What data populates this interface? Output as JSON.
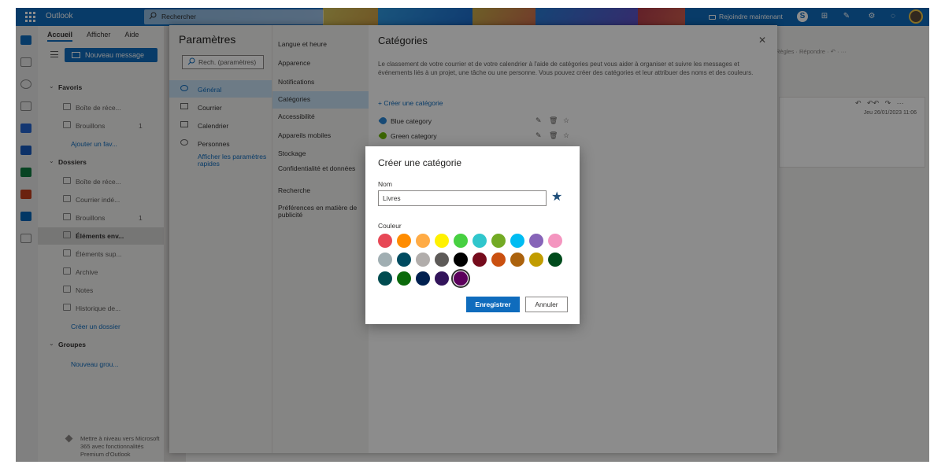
{
  "topbar": {
    "app_name": "Outlook",
    "search_placeholder": "Rechercher",
    "meet_now": "Rejoindre maintenant",
    "bg_color": "#0f6cbd"
  },
  "ribbon": {
    "tabs": [
      "Accueil",
      "Afficher",
      "Aide"
    ],
    "new_message": "Nouveau message"
  },
  "nav": {
    "favorites": "Favoris",
    "fav_inbox": "Boîte de réce...",
    "fav_drafts": "Brouillons",
    "fav_drafts_count": "1",
    "add_favorite": "Ajouter un fav...",
    "folders": "Dossiers",
    "inbox": "Boîte de réce...",
    "junk": "Courrier indé...",
    "drafts": "Brouillons",
    "drafts_count": "1",
    "sent": "Éléments env...",
    "deleted": "Éléments sup...",
    "archive": "Archive",
    "notes": "Notes",
    "history": "Historique de...",
    "create_folder": "Créer un dossier",
    "groups": "Groupes",
    "new_group": "Nouveau grou...",
    "upgrade": "Mettre à niveau vers Microsoft 365 avec fonctionnalités Premium d'Outlook"
  },
  "reading": {
    "date": "Jeu 26/01/2023 11:06",
    "toolbar_text": "Règles ·  Répondre ·  ↶  ·  ···"
  },
  "settings": {
    "title": "Paramètres",
    "search_placeholder": "Rech. (paramètres)",
    "categories": [
      "Général",
      "Courrier",
      "Calendrier",
      "Personnes"
    ],
    "quick_link": "Afficher les paramètres rapides",
    "subcategories": [
      "Langue et heure",
      "Apparence",
      "Notifications",
      "Catégories",
      "Accessibilité",
      "Appareils mobiles",
      "Stockage",
      "Confidentialité et données",
      "Recherche",
      "Préférences en matière de publicité"
    ],
    "page_title": "Catégories",
    "description": "Le classement de votre courrier et de votre calendrier à l'aide de catégories peut vous aider à organiser et suivre les messages et événements liés à un projet, une tâche ou une personne. Vous pouvez créer des catégories et leur attribuer des noms et des couleurs.",
    "create_link": "Créer une catégorie",
    "category_list": [
      {
        "name": "Blue category",
        "color": "#2b88d8"
      },
      {
        "name": "Green category",
        "color": "#6bb700"
      }
    ]
  },
  "modal": {
    "title": "Créer une catégorie",
    "name_label": "Nom",
    "name_value": "Livres",
    "color_label": "Couleur",
    "save": "Enregistrer",
    "cancel": "Annuler",
    "selected_color_index": 24,
    "colors": [
      "#e74856",
      "#ff8c00",
      "#ffab45",
      "#fff100",
      "#47d041",
      "#30c6cc",
      "#73aa24",
      "#00bcf2",
      "#8764b8",
      "#f495bf",
      "#a0aeb2",
      "#004b60",
      "#b1adab",
      "#5d5a58",
      "#000000",
      "#750b1c",
      "#ca5010",
      "#ab620d",
      "#c19c00",
      "#004b1c",
      "#004b50",
      "#0b6a0b",
      "#002050",
      "#32145a",
      "#5c005c"
    ]
  }
}
